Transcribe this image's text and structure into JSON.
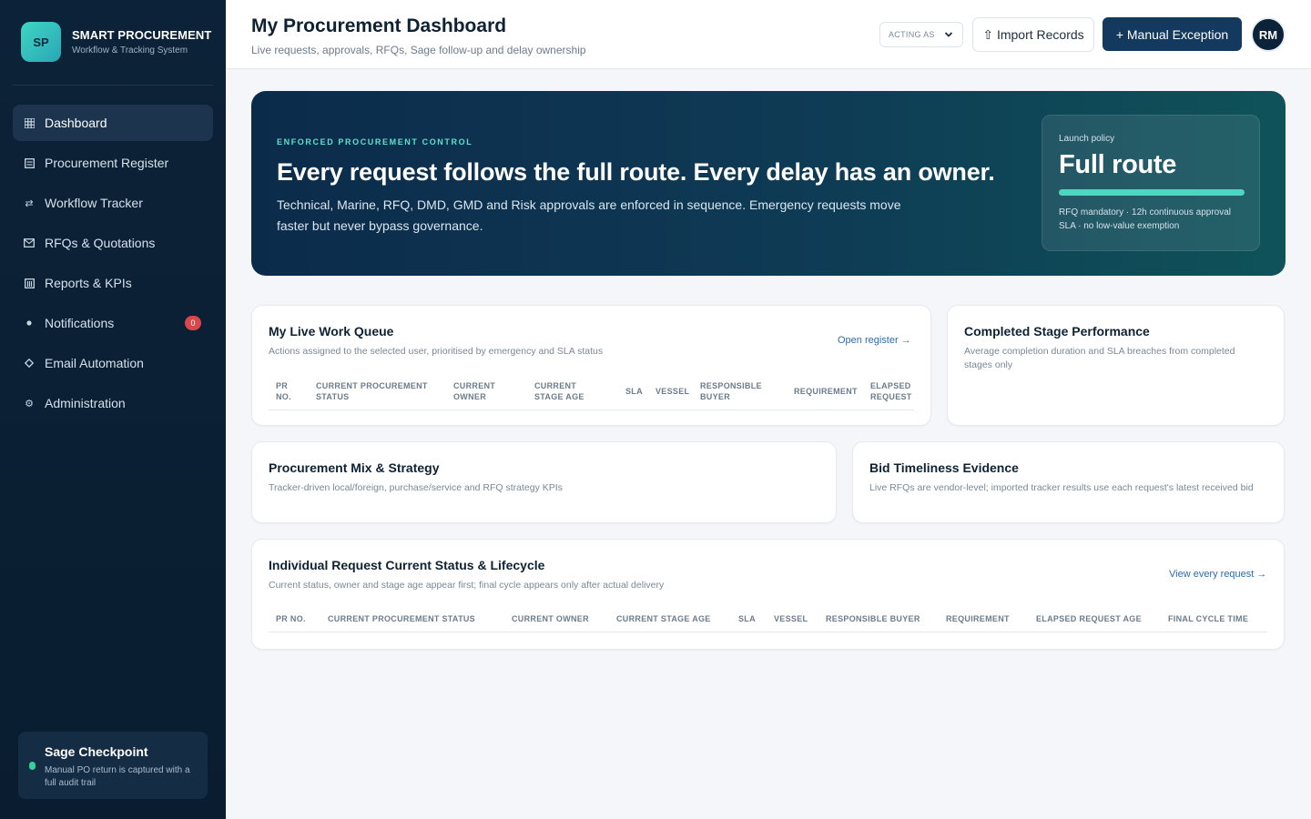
{
  "brand": {
    "logo": "SP",
    "name": "SMART PROCUREMENT",
    "subtitle": "Workflow & Tracking System"
  },
  "sidebar": {
    "items": [
      {
        "label": "Dashboard",
        "icon": "grid-icon"
      },
      {
        "label": "Procurement Register",
        "icon": "list-icon"
      },
      {
        "label": "Workflow Tracker",
        "icon": "swap-icon"
      },
      {
        "label": "RFQs & Quotations",
        "icon": "mail-icon"
      },
      {
        "label": "Reports & KPIs",
        "icon": "chart-icon"
      },
      {
        "label": "Notifications",
        "icon": "bell-icon",
        "badge": "0"
      },
      {
        "label": "Email Automation",
        "icon": "diamond-icon"
      },
      {
        "label": "Administration",
        "icon": "gear-icon"
      }
    ],
    "sage": {
      "title": "Sage Checkpoint",
      "text": "Manual PO return is captured with a full audit trail"
    }
  },
  "header": {
    "title": "My Procurement Dashboard",
    "subtitle": "Live requests, approvals, RFQs, Sage follow-up and delay ownership",
    "acting_as": "ACTING AS",
    "import_label": "⇧ Import Records",
    "manual_label": "+ Manual Exception",
    "avatar": "RM"
  },
  "hero": {
    "eyebrow": "ENFORCED PROCUREMENT CONTROL",
    "title": "Every request follows the full route. Every delay has an owner.",
    "text": "Technical, Marine, RFQ, DMD, GMD and Risk approvals are enforced in sequence. Emergency requests move faster but never bypass governance.",
    "policy_label": "Launch policy",
    "policy_value": "Full route",
    "policy_progress": 1.0,
    "policy_note": "RFQ mandatory · 12h continuous approval SLA · no low-value exemption"
  },
  "work_queue": {
    "title": "My Live Work Queue",
    "subtitle": "Actions assigned to the selected user, prioritised by emergency and SLA status",
    "link": "Open register →",
    "columns": [
      "PR NO.",
      "CURRENT PROCUREMENT STATUS",
      "CURRENT OWNER",
      "CURRENT STAGE AGE",
      "SLA",
      "VESSEL",
      "RESPONSIBLE BUYER",
      "REQUIREMENT",
      "ELAPSED REQUEST AGE"
    ]
  },
  "stage_performance": {
    "title": "Completed Stage Performance",
    "subtitle": "Average completion duration and SLA breaches from completed stages only"
  },
  "mix": {
    "title": "Procurement Mix & Strategy",
    "subtitle": "Tracker-driven local/foreign, purchase/service and RFQ strategy KPIs"
  },
  "bid": {
    "title": "Bid Timeliness Evidence",
    "subtitle": "Live RFQs are vendor-level; imported tracker results use each request's latest received bid"
  },
  "lifecycle": {
    "title": "Individual Request Current Status & Lifecycle",
    "subtitle": "Current status, owner and stage age appear first; final cycle appears only after actual delivery",
    "link": "View every request →",
    "columns": [
      "PR NO.",
      "CURRENT PROCUREMENT STATUS",
      "CURRENT OWNER",
      "CURRENT STAGE AGE",
      "SLA",
      "VESSEL",
      "RESPONSIBLE BUYER",
      "REQUIREMENT",
      "ELAPSED REQUEST AGE",
      "FINAL CYCLE TIME"
    ]
  }
}
